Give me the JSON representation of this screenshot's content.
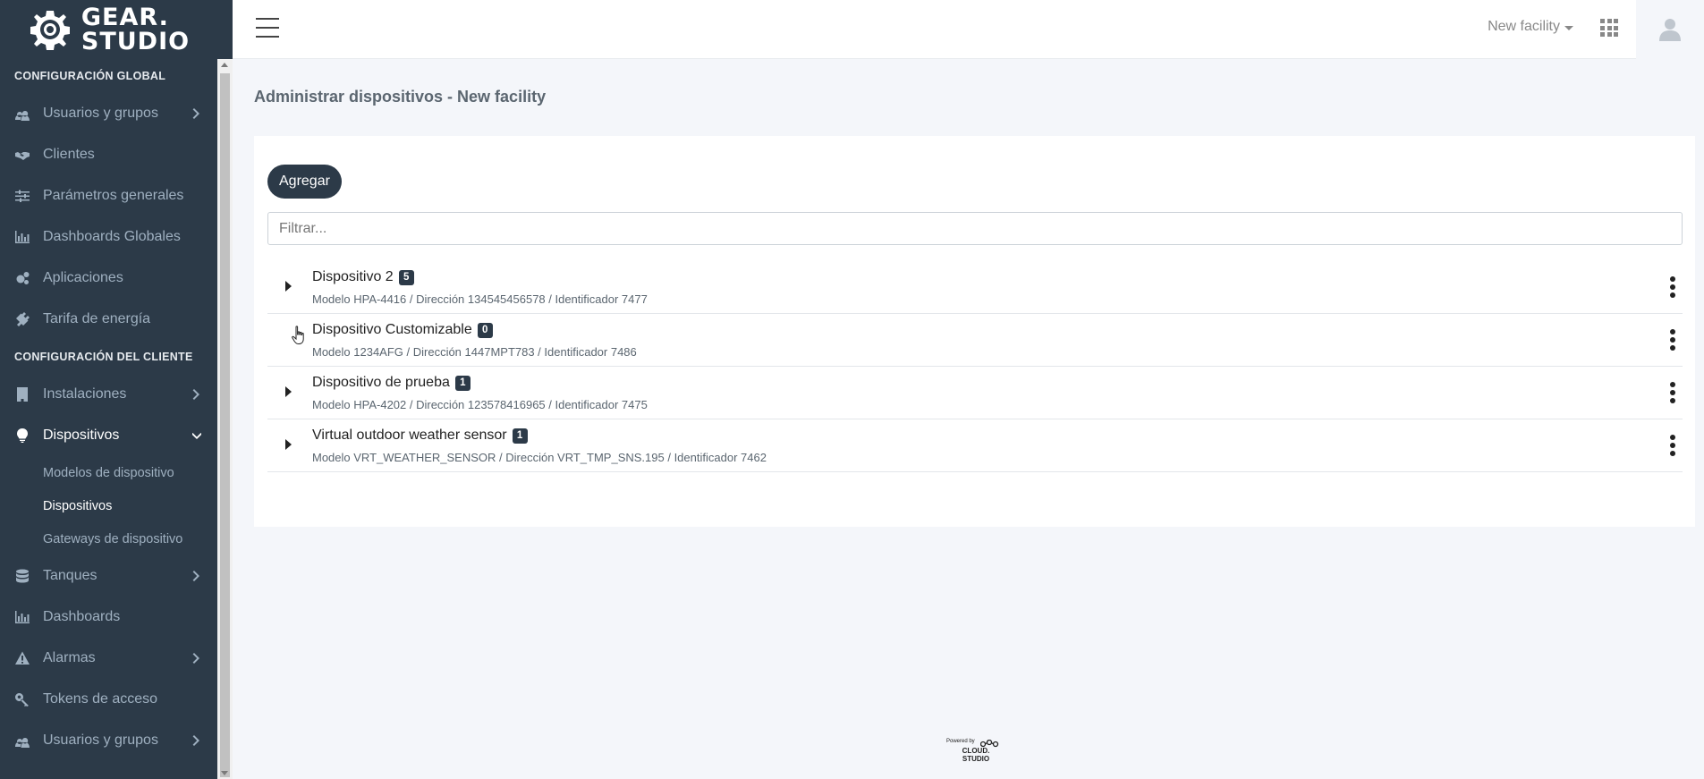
{
  "brand": {
    "line1": "GEAR.",
    "line2": "STUDIO"
  },
  "sidebar": {
    "section_global": "CONFIGURACIÓN GLOBAL",
    "global_items": [
      {
        "label": "Usuarios y grupos",
        "icon": "users-icon",
        "has_children": true
      },
      {
        "label": "Clientes",
        "icon": "handshake-icon",
        "has_children": false
      },
      {
        "label": "Parámetros generales",
        "icon": "sliders-icon",
        "has_children": false
      },
      {
        "label": "Dashboards Globales",
        "icon": "bar-chart-icon",
        "has_children": false
      },
      {
        "label": "Aplicaciones",
        "icon": "cogs-icon",
        "has_children": false
      },
      {
        "label": "Tarifa de energía",
        "icon": "plug-icon",
        "has_children": false
      }
    ],
    "section_client": "CONFIGURACIÓN DEL CLIENTE",
    "client_items": [
      {
        "label": "Instalaciones",
        "icon": "building-icon",
        "has_children": true
      },
      {
        "label": "Dispositivos",
        "icon": "lightbulb-icon",
        "has_children": true,
        "expanded": true
      }
    ],
    "dispositivos_sub": [
      {
        "label": "Modelos de dispositivo"
      },
      {
        "label": "Dispositivos",
        "active": true
      },
      {
        "label": "Gateways de dispositivo"
      }
    ],
    "client_items_after": [
      {
        "label": "Tanques",
        "icon": "database-icon",
        "has_children": true
      },
      {
        "label": "Dashboards",
        "icon": "bar-chart-icon",
        "has_children": false
      },
      {
        "label": "Alarmas",
        "icon": "warning-icon",
        "has_children": true
      },
      {
        "label": "Tokens de acceso",
        "icon": "key-icon",
        "has_children": false
      },
      {
        "label": "Usuarios y grupos",
        "icon": "users-icon",
        "has_children": true
      }
    ]
  },
  "header": {
    "facility_label": "New facility"
  },
  "main": {
    "title": "Administrar dispositivos - New facility",
    "add_label": "Agregar",
    "filter_placeholder": "Filtrar...",
    "devices": [
      {
        "name": "Dispositivo 2",
        "count": "5",
        "meta": "Modelo HPA-4416 / Dirección 134545456578 / Identificador 7477",
        "expandable": true
      },
      {
        "name": "Dispositivo Customizable",
        "count": "0",
        "meta": "Modelo 1234AFG / Dirección 1447MPT783 / Identificador 7486",
        "expandable": false
      },
      {
        "name": "Dispositivo de prueba",
        "count": "1",
        "meta": "Modelo HPA-4202 / Dirección 123578416965 / Identificador 7475",
        "expandable": true
      },
      {
        "name": "Virtual outdoor weather sensor",
        "count": "1",
        "meta": "Modelo VRT_WEATHER_SENSOR / Dirección VRT_TMP_SNS.195 / Identificador 7462",
        "expandable": true
      }
    ]
  },
  "footer": {
    "powered": "Powered by",
    "brand_line1": "CLOUD.",
    "brand_line2": "STUDIO"
  },
  "colors": {
    "sidebar_bg": "#2c3a48",
    "accent": "#2c3a48",
    "page_bg": "#f4f6fa"
  }
}
